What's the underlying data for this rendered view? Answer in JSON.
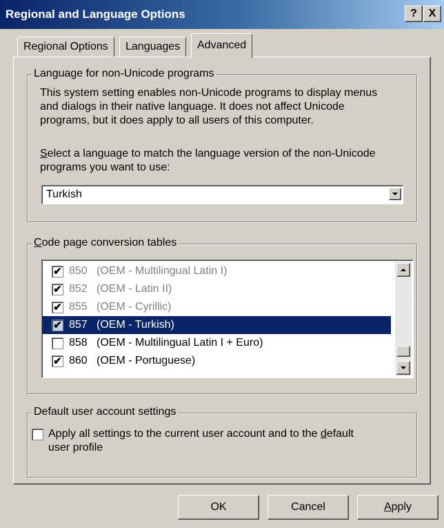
{
  "window": {
    "title": "Regional and Language Options",
    "help_glyph": "?",
    "close_glyph": "X"
  },
  "tabs": [
    {
      "label": "Regional Options"
    },
    {
      "label": "Languages"
    },
    {
      "label": "Advanced",
      "active": true
    }
  ],
  "non_unicode": {
    "legend": "Language for non-Unicode programs",
    "description_lines": [
      "This system setting enables non-Unicode programs to display menus",
      "and dialogs in their native language. It does not affect Unicode",
      "programs, but it does apply to all users of this computer."
    ],
    "select_prompt_line1_rest": "elect a language to match the language version of the non-Unicode",
    "select_prompt_line1_mnemonic": "S",
    "select_prompt_line2": "programs you want to use:",
    "selected_language": "Turkish"
  },
  "code_pages": {
    "legend_mnemonic": "C",
    "legend_rest": "ode page conversion tables",
    "items": [
      {
        "code": "850",
        "name": "(OEM - Multilingual Latin I)",
        "checked": true,
        "dim": true
      },
      {
        "code": "852",
        "name": "(OEM - Latin II)",
        "checked": true,
        "dim": true
      },
      {
        "code": "855",
        "name": "(OEM - Cyrillic)",
        "checked": true,
        "dim": true
      },
      {
        "code": "857",
        "name": "(OEM - Turkish)",
        "checked": true,
        "selected": true
      },
      {
        "code": "858",
        "name": "(OEM - Multilingual Latin I + Euro)",
        "checked": false
      },
      {
        "code": "860",
        "name": "(OEM - Portuguese)",
        "checked": true
      }
    ]
  },
  "default_user": {
    "legend": "Default user account settings",
    "checkbox_checked": false,
    "label_line1_before": "Apply all settings to the current user account and to the ",
    "label_line1_mnemonic": "d",
    "label_line1_after": "efault",
    "label_line2": "user profile"
  },
  "buttons": {
    "ok": "OK",
    "cancel": "Cancel",
    "apply_mnemonic": "A",
    "apply_rest": "pply"
  },
  "icons": {
    "check": "✔",
    "help": "help-icon",
    "close": "close-icon"
  },
  "colors": {
    "title_start": "#0a246a",
    "title_end": "#a6caf0",
    "face": "#d4d0c8",
    "selection": "#0a246a"
  }
}
